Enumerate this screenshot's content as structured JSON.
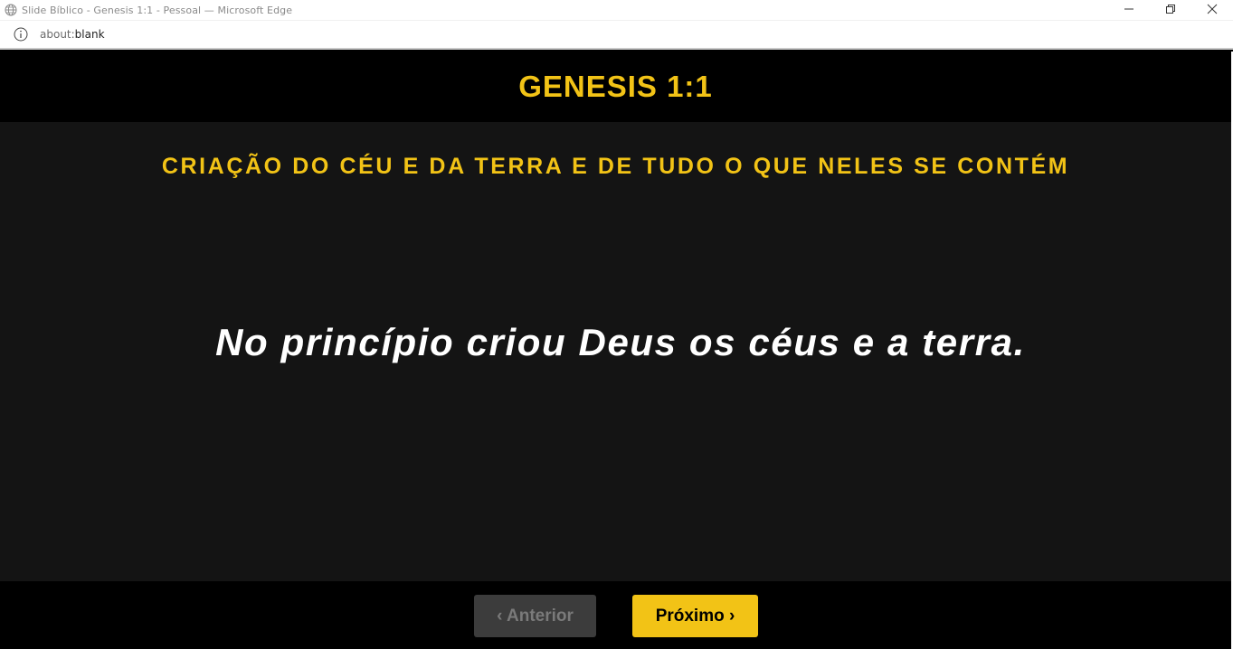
{
  "window": {
    "title": "Slide Bíblico - Genesis 1:1 - Pessoal — Microsoft Edge",
    "controls": [
      "minimize-icon",
      "restore-icon",
      "close-icon"
    ]
  },
  "address_bar": {
    "url_scheme": "about:",
    "url_rest": "blank",
    "icon": "info-icon"
  },
  "slide": {
    "reference": "GENESIS 1:1",
    "subtitle": "CRIAÇÃO DO CÉU E DA TERRA E DE TUDO O QUE NELES SE CONTÉM",
    "verse": "No princípio criou Deus os céus e a terra."
  },
  "navigation": {
    "prev_label": "‹ Anterior",
    "next_label": "Próximo ›",
    "prev_enabled": false,
    "next_enabled": true
  },
  "colors": {
    "accent": "#f2c316",
    "background": "#000000",
    "content_background": "#141414",
    "verse_text": "#ffffff",
    "disabled_button": "#3c3c3c"
  }
}
